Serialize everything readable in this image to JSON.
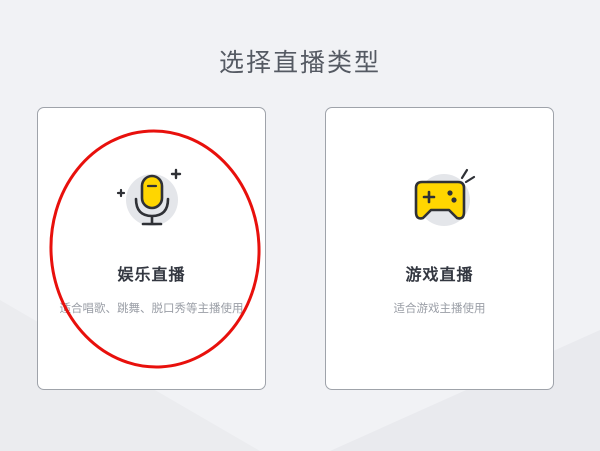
{
  "page": {
    "title": "选择直播类型"
  },
  "cards": {
    "entertainment": {
      "icon": "microphone-icon",
      "title": "娱乐直播",
      "description": "适合唱歌、跳舞、脱口秀等主播使用"
    },
    "game": {
      "icon": "gamepad-icon",
      "title": "游戏直播",
      "description": "适合游戏主播使用"
    }
  },
  "annotation": {
    "shape": "ellipse",
    "color": "#e8100c"
  },
  "colors": {
    "background": "#f1f2f5",
    "card_border": "#9fa3aa",
    "icon_yellow": "#ffd600",
    "icon_outline": "#2f3136",
    "icon_circle": "#e4e6ea"
  }
}
